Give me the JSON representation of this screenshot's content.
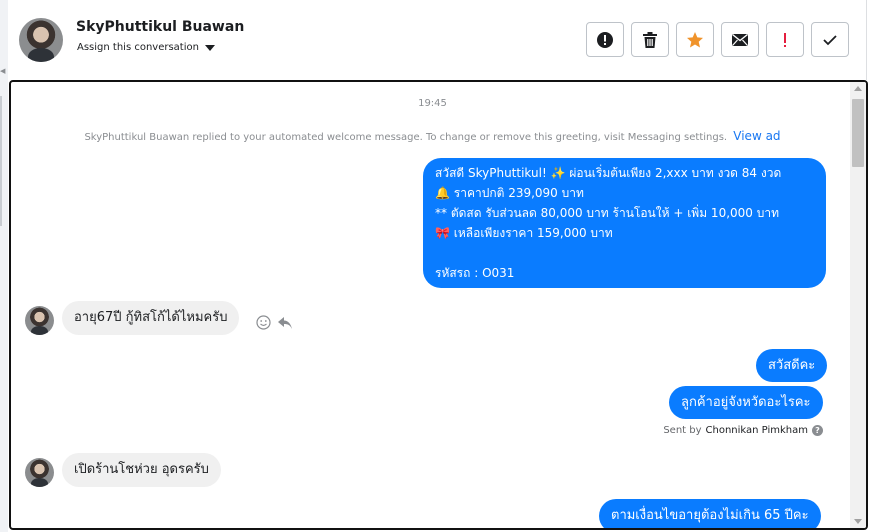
{
  "header": {
    "name": "SkyPhuttikul Buawan",
    "assign_label": "Assign this conversation"
  },
  "actions": [
    {
      "icon": "alert-circle-icon",
      "color": "#1c1e21"
    },
    {
      "icon": "trash-icon",
      "color": "#1c1e21"
    },
    {
      "icon": "star-icon",
      "color": "#f0932b"
    },
    {
      "icon": "envelope-icon",
      "color": "#1c1e21"
    },
    {
      "icon": "exclamation-icon",
      "color": "#e41e3f"
    },
    {
      "icon": "checkmark-icon",
      "color": "#1c1e21"
    }
  ],
  "chat": {
    "timestamp": "19:45",
    "notice_text": "SkyPhuttikul Buawan replied to your automated welcome message. To change or remove this greeting, visit Messaging settings.",
    "notice_link": "View ad",
    "welcome_lines": [
      "สวัสดี SkyPhuttikul! ✨  ผ่อนเริ่มต้นเพียง 2,xxx บาท งวด 84 งวด",
      "🔔 ราคาปกติ 239,090 บาท",
      "** ตัดสด รับส่วนลด 80,000 บาท ร้านโอนให้ + เพิ่ม 10,000 บาท",
      "🎀  เหลือเพียงราคา 159,000 บาท",
      "",
      "รหัสรถ : O031"
    ],
    "incoming_1": "อายุ67ปี กู้ทิสโก้ได้ไหมครับ",
    "outgoing_hello": "สวัสดีคะ",
    "outgoing_province": "ลูกค้าอยู่จังหวัดอะไรคะ",
    "sent_by_prefix": "Sent by",
    "sent_by_name": "Chonnikan Pimkham",
    "incoming_2": "เปิดร้านโชห่วย อุดรครับ",
    "outgoing_age": "ตามเงื่อนไขอายุต้องไม่เกิน 65 ปีคะ"
  },
  "colors": {
    "brand_blue": "#0a7cff",
    "incoming_bg": "#f0f0f0"
  }
}
